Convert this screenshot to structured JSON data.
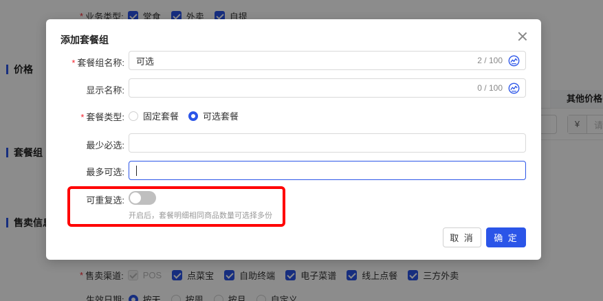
{
  "background": {
    "business_type": {
      "label": "业务类型:",
      "options": [
        "堂食",
        "外卖",
        "自提"
      ]
    },
    "sections": {
      "price": "价格",
      "combo_group": "套餐组",
      "sales_info": "售卖信息"
    },
    "other_price_header": "其他价格",
    "currency_symbol": "¥",
    "placeholder_partial": "请",
    "sales_channel": {
      "label": "售卖渠道:",
      "options": [
        "POS",
        "点菜宝",
        "自助终端",
        "电子菜谱",
        "线上点餐",
        "三方外卖"
      ]
    },
    "effective_date": {
      "label": "生效日期:",
      "options": [
        "按天",
        "按周",
        "按月",
        "自定义"
      ]
    }
  },
  "modal": {
    "title": "添加套餐组",
    "group_name": {
      "label": "套餐组名称:",
      "value": "可选",
      "count": "2 / 100"
    },
    "display_name": {
      "label": "显示名称:",
      "value": "",
      "count": "0 / 100"
    },
    "combo_type": {
      "label": "套餐类型:",
      "options": [
        "固定套餐",
        "可选套餐"
      ],
      "selected": "可选套餐"
    },
    "min_select": {
      "label": "最少必选:",
      "value": ""
    },
    "max_select": {
      "label": "最多可选:",
      "value": ""
    },
    "repeatable": {
      "label": "可重复选:",
      "enabled": false,
      "hint": "开启后，套餐明细相同商品数量可选择多份"
    },
    "cancel_label": "取 消",
    "ok_label": "确 定"
  },
  "colors": {
    "primary": "#2b55e8",
    "required": "#f5222d",
    "highlight": "#ff0000"
  },
  "icons": {
    "translate": "translate-icon",
    "close": "close-icon"
  }
}
